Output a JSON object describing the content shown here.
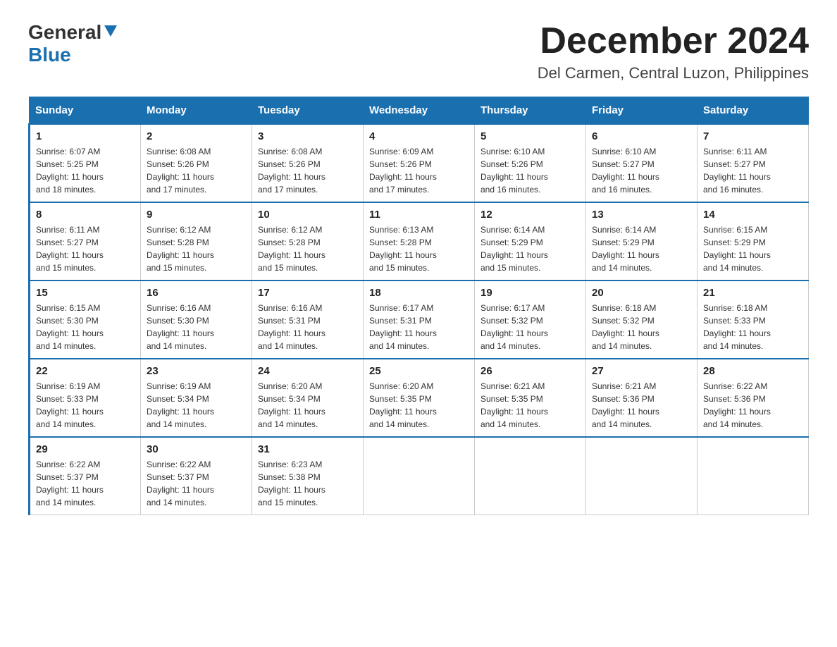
{
  "logo": {
    "general": "General",
    "blue": "Blue"
  },
  "title": "December 2024",
  "location": "Del Carmen, Central Luzon, Philippines",
  "days_of_week": [
    "Sunday",
    "Monday",
    "Tuesday",
    "Wednesday",
    "Thursday",
    "Friday",
    "Saturday"
  ],
  "weeks": [
    [
      {
        "day": "1",
        "sunrise": "6:07 AM",
        "sunset": "5:25 PM",
        "daylight": "11 hours and 18 minutes."
      },
      {
        "day": "2",
        "sunrise": "6:08 AM",
        "sunset": "5:26 PM",
        "daylight": "11 hours and 17 minutes."
      },
      {
        "day": "3",
        "sunrise": "6:08 AM",
        "sunset": "5:26 PM",
        "daylight": "11 hours and 17 minutes."
      },
      {
        "day": "4",
        "sunrise": "6:09 AM",
        "sunset": "5:26 PM",
        "daylight": "11 hours and 17 minutes."
      },
      {
        "day": "5",
        "sunrise": "6:10 AM",
        "sunset": "5:26 PM",
        "daylight": "11 hours and 16 minutes."
      },
      {
        "day": "6",
        "sunrise": "6:10 AM",
        "sunset": "5:27 PM",
        "daylight": "11 hours and 16 minutes."
      },
      {
        "day": "7",
        "sunrise": "6:11 AM",
        "sunset": "5:27 PM",
        "daylight": "11 hours and 16 minutes."
      }
    ],
    [
      {
        "day": "8",
        "sunrise": "6:11 AM",
        "sunset": "5:27 PM",
        "daylight": "11 hours and 15 minutes."
      },
      {
        "day": "9",
        "sunrise": "6:12 AM",
        "sunset": "5:28 PM",
        "daylight": "11 hours and 15 minutes."
      },
      {
        "day": "10",
        "sunrise": "6:12 AM",
        "sunset": "5:28 PM",
        "daylight": "11 hours and 15 minutes."
      },
      {
        "day": "11",
        "sunrise": "6:13 AM",
        "sunset": "5:28 PM",
        "daylight": "11 hours and 15 minutes."
      },
      {
        "day": "12",
        "sunrise": "6:14 AM",
        "sunset": "5:29 PM",
        "daylight": "11 hours and 15 minutes."
      },
      {
        "day": "13",
        "sunrise": "6:14 AM",
        "sunset": "5:29 PM",
        "daylight": "11 hours and 14 minutes."
      },
      {
        "day": "14",
        "sunrise": "6:15 AM",
        "sunset": "5:29 PM",
        "daylight": "11 hours and 14 minutes."
      }
    ],
    [
      {
        "day": "15",
        "sunrise": "6:15 AM",
        "sunset": "5:30 PM",
        "daylight": "11 hours and 14 minutes."
      },
      {
        "day": "16",
        "sunrise": "6:16 AM",
        "sunset": "5:30 PM",
        "daylight": "11 hours and 14 minutes."
      },
      {
        "day": "17",
        "sunrise": "6:16 AM",
        "sunset": "5:31 PM",
        "daylight": "11 hours and 14 minutes."
      },
      {
        "day": "18",
        "sunrise": "6:17 AM",
        "sunset": "5:31 PM",
        "daylight": "11 hours and 14 minutes."
      },
      {
        "day": "19",
        "sunrise": "6:17 AM",
        "sunset": "5:32 PM",
        "daylight": "11 hours and 14 minutes."
      },
      {
        "day": "20",
        "sunrise": "6:18 AM",
        "sunset": "5:32 PM",
        "daylight": "11 hours and 14 minutes."
      },
      {
        "day": "21",
        "sunrise": "6:18 AM",
        "sunset": "5:33 PM",
        "daylight": "11 hours and 14 minutes."
      }
    ],
    [
      {
        "day": "22",
        "sunrise": "6:19 AM",
        "sunset": "5:33 PM",
        "daylight": "11 hours and 14 minutes."
      },
      {
        "day": "23",
        "sunrise": "6:19 AM",
        "sunset": "5:34 PM",
        "daylight": "11 hours and 14 minutes."
      },
      {
        "day": "24",
        "sunrise": "6:20 AM",
        "sunset": "5:34 PM",
        "daylight": "11 hours and 14 minutes."
      },
      {
        "day": "25",
        "sunrise": "6:20 AM",
        "sunset": "5:35 PM",
        "daylight": "11 hours and 14 minutes."
      },
      {
        "day": "26",
        "sunrise": "6:21 AM",
        "sunset": "5:35 PM",
        "daylight": "11 hours and 14 minutes."
      },
      {
        "day": "27",
        "sunrise": "6:21 AM",
        "sunset": "5:36 PM",
        "daylight": "11 hours and 14 minutes."
      },
      {
        "day": "28",
        "sunrise": "6:22 AM",
        "sunset": "5:36 PM",
        "daylight": "11 hours and 14 minutes."
      }
    ],
    [
      {
        "day": "29",
        "sunrise": "6:22 AM",
        "sunset": "5:37 PM",
        "daylight": "11 hours and 14 minutes."
      },
      {
        "day": "30",
        "sunrise": "6:22 AM",
        "sunset": "5:37 PM",
        "daylight": "11 hours and 14 minutes."
      },
      {
        "day": "31",
        "sunrise": "6:23 AM",
        "sunset": "5:38 PM",
        "daylight": "11 hours and 15 minutes."
      },
      null,
      null,
      null,
      null
    ]
  ],
  "labels": {
    "sunrise": "Sunrise:",
    "sunset": "Sunset:",
    "daylight": "Daylight:"
  }
}
